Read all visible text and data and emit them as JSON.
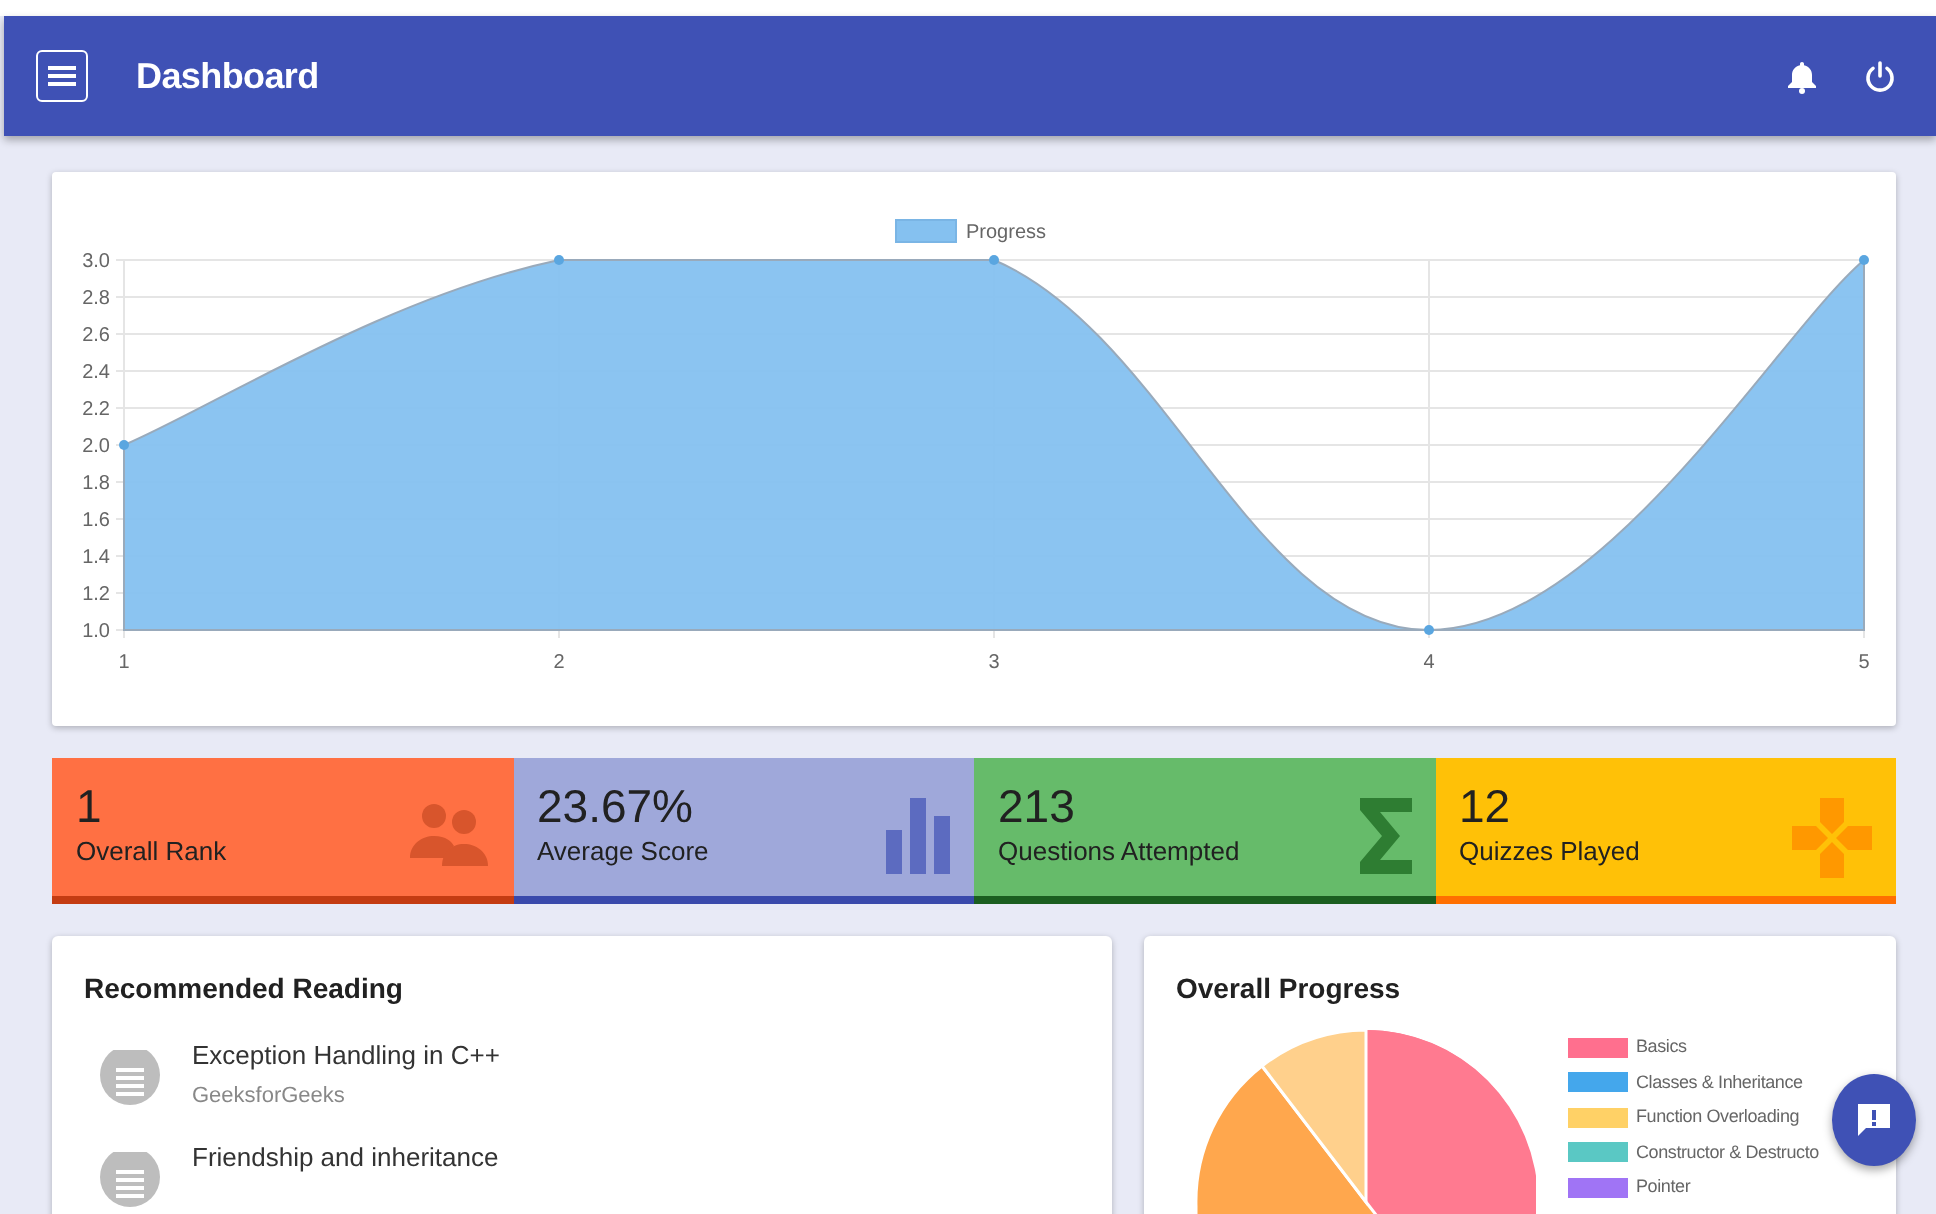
{
  "navbar": {
    "title": "Dashboard"
  },
  "progress_chart": {
    "chart_data": {
      "type": "area",
      "x": [
        1,
        2,
        3,
        4,
        5
      ],
      "series": [
        {
          "name": "Progress",
          "color": "#85c1f0",
          "values": [
            2,
            3,
            3,
            1,
            3
          ]
        }
      ],
      "xticks": [
        1,
        2,
        3,
        4,
        5
      ],
      "xlim": [
        1,
        5
      ],
      "grid": true,
      "ylim": [
        1,
        3
      ],
      "yticks": [
        {
          "value": 1,
          "label": "1.0"
        },
        {
          "value": 1.2,
          "label": "1.2"
        },
        {
          "value": 1.4,
          "label": "1.4"
        },
        {
          "value": 1.6,
          "label": "1.6"
        },
        {
          "value": 1.8,
          "label": "1.8"
        },
        {
          "value": 2,
          "label": "2.0"
        },
        {
          "value": 2.2,
          "label": "2.2"
        },
        {
          "value": 2.4,
          "label": "2.4"
        },
        {
          "value": 2.6,
          "label": "2.6"
        },
        {
          "value": 2.8,
          "label": "2.8"
        },
        {
          "value": 3,
          "label": "3.0"
        }
      ]
    }
  },
  "stats": [
    {
      "kind": "people",
      "value": "1",
      "label": "Overall Rank",
      "color": "#ff7043"
    },
    {
      "kind": "bars",
      "value": "23.67%",
      "label": "Average Score",
      "color": "#9fa8da"
    },
    {
      "kind": "sigma",
      "value": "213",
      "label": "Questions Attempted",
      "color": "#66bb6a"
    },
    {
      "kind": "gamepad",
      "value": "12",
      "label": "Quizzes Played",
      "color": "#ffc107"
    }
  ],
  "recommended_reading": {
    "title": "Recommended Reading",
    "items": [
      {
        "title": "Exception Handling in C++",
        "source": "GeeksforGeeks"
      },
      {
        "title": "Friendship and inheritance"
      }
    ]
  },
  "overall_progress": {
    "title": "Overall Progress",
    "legend": [
      {
        "label": "Basics",
        "color": "#ff6f8e"
      },
      {
        "label": "Classes & Inheritance",
        "color": "#44a7ec"
      },
      {
        "label": "Function Overloading",
        "color": "#ffd166"
      },
      {
        "label": "Constructor & Destructo",
        "color": "#5ac8c4"
      },
      {
        "label": "Pointer",
        "color": "#a074f5"
      }
    ]
  }
}
